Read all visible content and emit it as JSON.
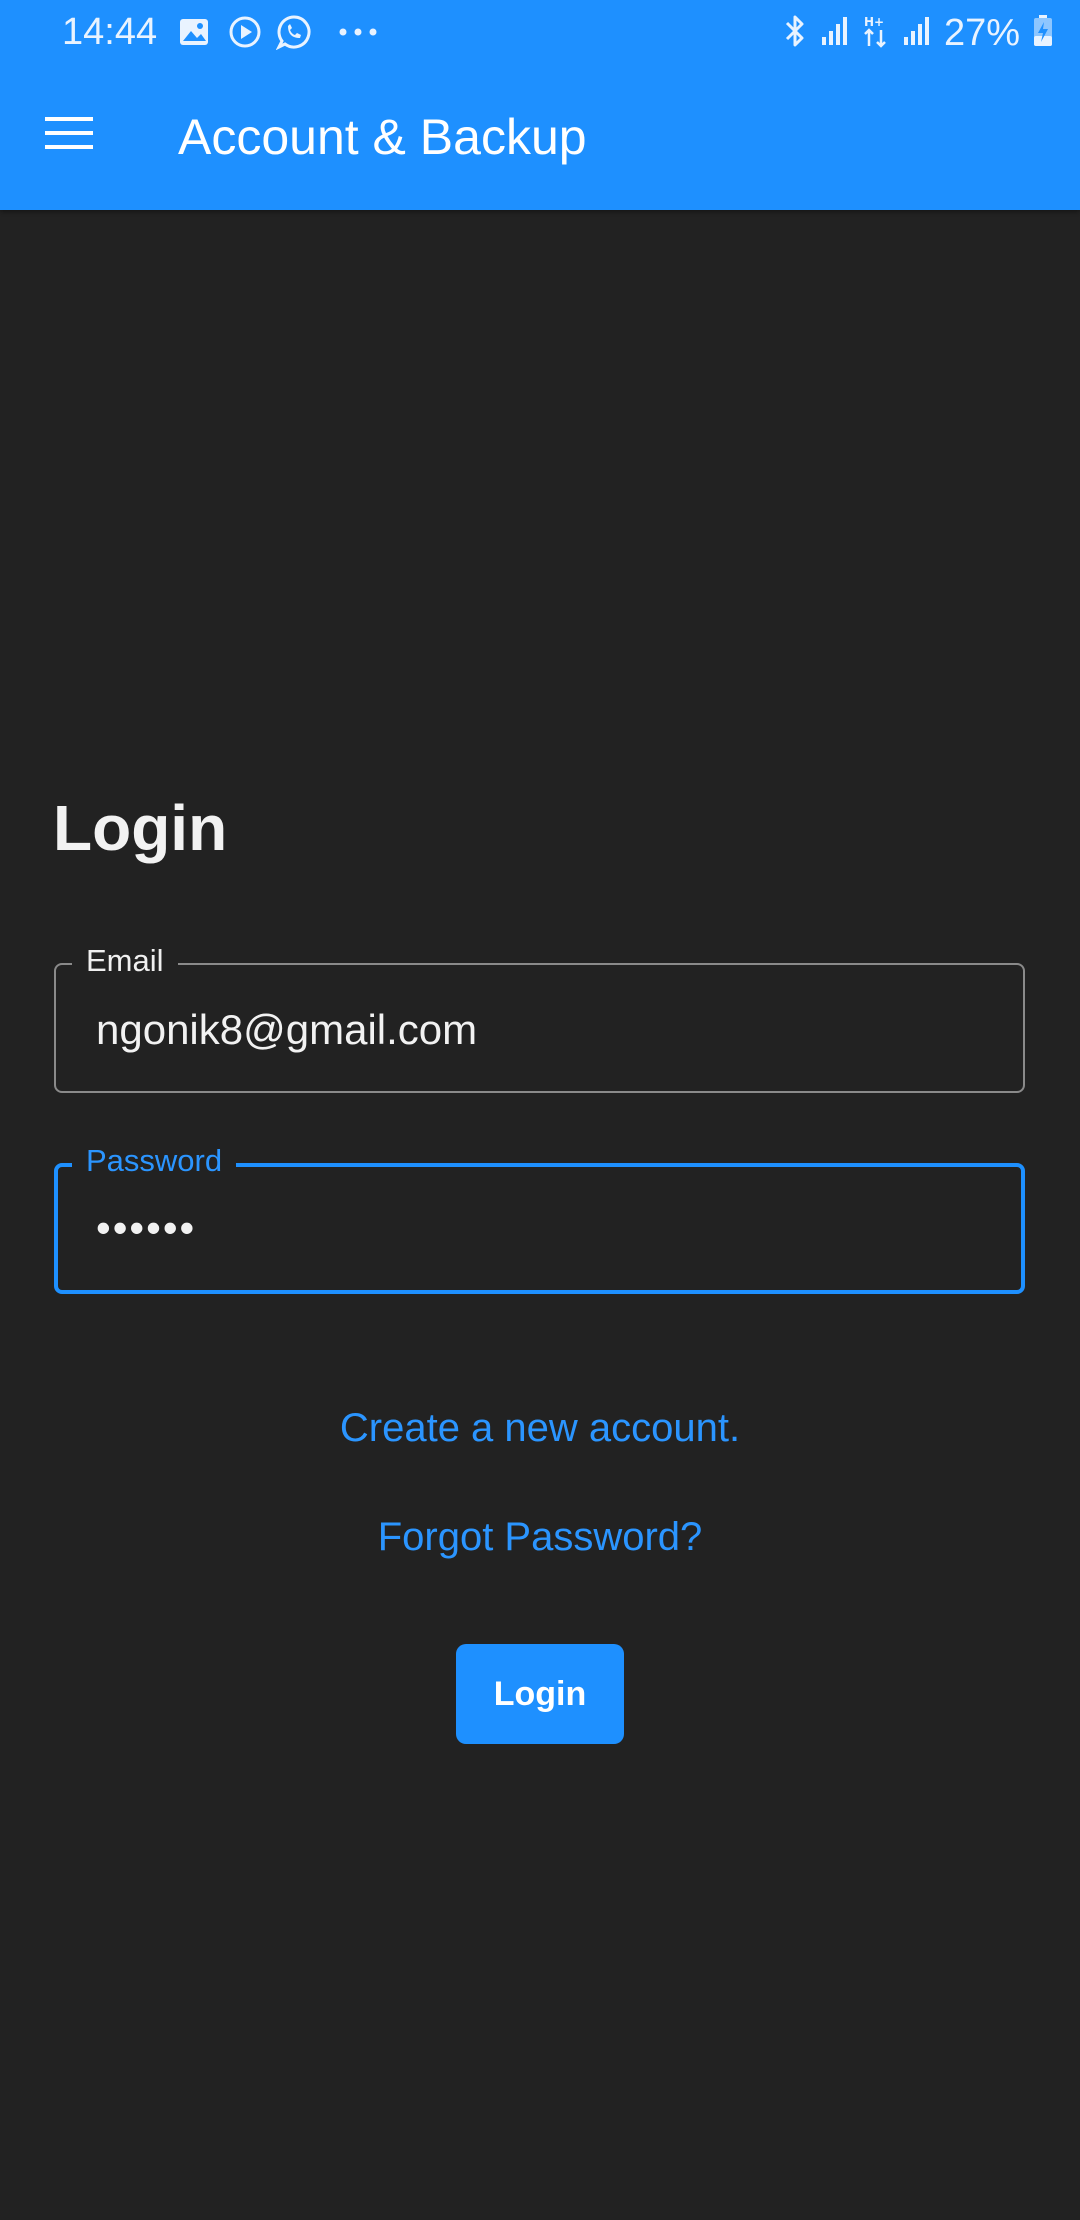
{
  "status_bar": {
    "time": "14:44",
    "battery_percent": "27%",
    "left_icons": [
      "gallery-icon",
      "play-icon",
      "whatsapp-icon",
      "more-dots-icon"
    ],
    "right_icons": [
      "bluetooth-icon",
      "signal-icon",
      "data-icon",
      "signal-icon",
      "battery-charging-icon"
    ]
  },
  "app_bar": {
    "title": "Account & Backup",
    "menu_icon": "hamburger-menu-icon",
    "color": "#1e90ff"
  },
  "login": {
    "title": "Login",
    "email_label": "Email",
    "email_value": "ngonik8@gmail.com",
    "password_label": "Password",
    "password_value": "••••••",
    "create_account_link": "Create a new account.",
    "forgot_password_link": "Forgot Password?",
    "login_button": "Login"
  },
  "colors": {
    "background": "#222222",
    "accent": "#1e90ff"
  }
}
